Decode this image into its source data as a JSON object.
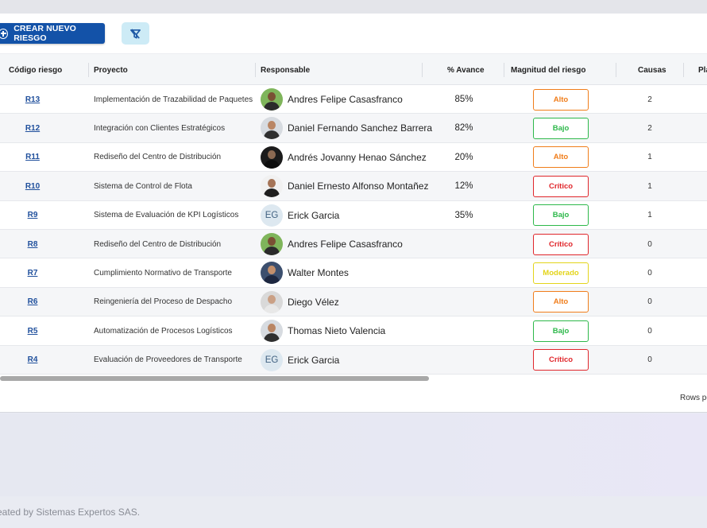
{
  "toolbar": {
    "create_label": "CREAR NUEVO RIESGO"
  },
  "table": {
    "headers": {
      "code": "Código riesgo",
      "project": "Proyecto",
      "owner": "Responsable",
      "progress": "% Avance",
      "magnitude": "Magnitud del riesgo",
      "causes": "Causas",
      "partial": "Pla"
    },
    "rows": [
      {
        "code": "R13",
        "project": "Implementación de Trazabilidad de Paquetes",
        "owner": "Andres Felipe Casasfranco",
        "avatar": "photo-green",
        "progress": "85%",
        "magnitude": "Alto",
        "causes": "2"
      },
      {
        "code": "R12",
        "project": "Integración con Clientes Estratégicos",
        "owner": "Daniel Fernando Sanchez Barrera",
        "avatar": "photo-light",
        "progress": "82%",
        "magnitude": "Bajo",
        "causes": "2"
      },
      {
        "code": "R11",
        "project": "Rediseño del Centro de Distribución",
        "owner": "Andrés Jovanny Henao Sánchez",
        "avatar": "photo-dark",
        "progress": "20%",
        "magnitude": "Alto",
        "causes": "1"
      },
      {
        "code": "R10",
        "project": "Sistema de Control de Flota",
        "owner": "Daniel Ernesto Alfonso Montañez",
        "avatar": "photo-white",
        "progress": "12%",
        "magnitude": "Crítico",
        "causes": "1"
      },
      {
        "code": "R9",
        "project": "Sistema de Evaluación de KPI Logísticos",
        "owner": "Erick Garcia",
        "avatar": "EG",
        "progress": "35%",
        "magnitude": "Bajo",
        "causes": "1"
      },
      {
        "code": "R8",
        "project": "Rediseño del Centro de Distribución",
        "owner": "Andres Felipe Casasfranco",
        "avatar": "photo-green",
        "progress": "",
        "magnitude": "Crítico",
        "causes": "0"
      },
      {
        "code": "R7",
        "project": "Cumplimiento Normativo de Transporte",
        "owner": "Walter Montes",
        "avatar": "photo-blue",
        "progress": "",
        "magnitude": "Moderado",
        "causes": "0"
      },
      {
        "code": "R6",
        "project": "Reingeniería del Proceso de Despacho",
        "owner": "Diego Vélez",
        "avatar": "photo-gray",
        "progress": "",
        "magnitude": "Alto",
        "causes": "0"
      },
      {
        "code": "R5",
        "project": "Automatización de Procesos Logísticos",
        "owner": "Thomas Nieto Valencia",
        "avatar": "photo-light",
        "progress": "",
        "magnitude": "Bajo",
        "causes": "0"
      },
      {
        "code": "R4",
        "project": "Evaluación de Proveedores de Transporte",
        "owner": "Erick Garcia",
        "avatar": "EG",
        "progress": "",
        "magnitude": "Crítico",
        "causes": "0"
      }
    ]
  },
  "magnitude_colors": {
    "Alto": "#f07d1a",
    "Bajo": "#2db84a",
    "Crítico": "#e0262b",
    "Moderado": "#e3d41a"
  },
  "pagination": {
    "rows_label": "Rows po"
  },
  "footer": {
    "credit": "eated by Sistemas Expertos SAS."
  },
  "icons": {
    "create": "plus-circle-icon",
    "filter": "filter-off-icon"
  }
}
